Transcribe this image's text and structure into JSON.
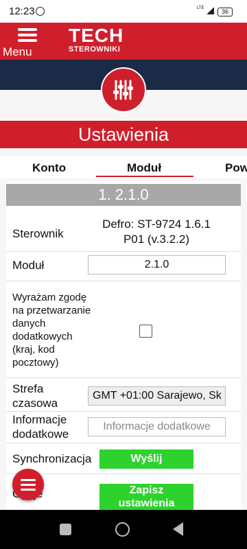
{
  "status_bar": {
    "time": "12:23",
    "network": "LTE",
    "battery": "36"
  },
  "header": {
    "menu_label": "Menu",
    "logo_main": "TECH",
    "logo_sub": "STEROWNIKI"
  },
  "page_title": "Ustawienia",
  "tabs": [
    {
      "label": "Konto",
      "active": false
    },
    {
      "label": "Moduł",
      "active": true
    },
    {
      "label": "Pow",
      "active": false
    }
  ],
  "module": {
    "version_banner": "1. 2.1.0",
    "sterownik_label": "Sterownik",
    "sterownik_value_line1": "Defro: ST-9724 1.6.1",
    "sterownik_value_line2": "P01 (v.3.2.2)",
    "modul_label": "Moduł",
    "modul_value": "2.1.0",
    "consent_label": [
      "Wyrażam zgodę",
      "na przetwarzanie",
      "danych",
      "dodatkowych",
      "(kraj, kod",
      "pocztowy)"
    ],
    "consent_checked": false,
    "timezone_label_line1": "Strefa",
    "timezone_label_line2": "czasowa",
    "timezone_value": "GMT +01:00 Sarajewo, Sk",
    "info_label_line1": "Informacje",
    "info_label_line2": "dodatkowe",
    "info_placeholder": "Informacje dodatkowe",
    "sync_label": "Synchronizacja",
    "sync_button": "Wyślij",
    "options_label": "Opcje",
    "save_button_line1": "Zapisz",
    "save_button_line2": "ustawienia"
  },
  "colors": {
    "brand_red": "#cf1f2d",
    "navy": "#1b2a46",
    "green": "#2dd22d",
    "banner_gray": "#a8a8a8"
  }
}
